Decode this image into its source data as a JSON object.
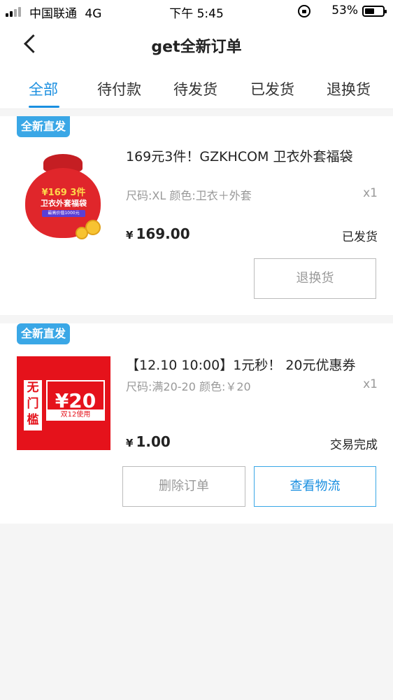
{
  "status_bar": {
    "carrier": "中国联通",
    "network": "4G",
    "time": "下午 5:45",
    "battery_percent": "53%",
    "battery_level": 0.53
  },
  "nav": {
    "title": "get全新订单",
    "back_icon": "chevron-left-icon"
  },
  "tabs": [
    {
      "label": "全部",
      "active": true
    },
    {
      "label": "待付款",
      "active": false
    },
    {
      "label": "待发货",
      "active": false
    },
    {
      "label": "已发货",
      "active": false
    },
    {
      "label": "退换货",
      "active": false
    }
  ],
  "colors": {
    "accent": "#1a8fe0",
    "badge": "#3aa7e6",
    "background": "#f5f5f5"
  },
  "orders": [
    {
      "badge": "全新直发",
      "title": "169元3件！GZKHCOM 卫衣外套福袋",
      "spec": "尺码:XL 颜色:卫衣＋外套",
      "qty": "x1",
      "currency": "¥",
      "price": "169.00",
      "status": "已发货",
      "image": {
        "price_text": "¥169 3件",
        "name_text": "卫衣外套福袋",
        "tag_text": "最高价值1000元"
      },
      "buttons": [
        "退换货"
      ]
    },
    {
      "badge": "全新直发",
      "title": "【12.10 10:00】1元秒！ 20元优惠券",
      "spec": "尺码:满20-20 颜色:￥20",
      "qty": "x1",
      "currency": "¥",
      "price": "1.00",
      "status": "交易完成",
      "image": {
        "left_text": "无门槛",
        "main_text": "¥20",
        "sub_text": "双12使用"
      },
      "buttons": [
        "删除订单",
        "查看物流"
      ]
    }
  ]
}
